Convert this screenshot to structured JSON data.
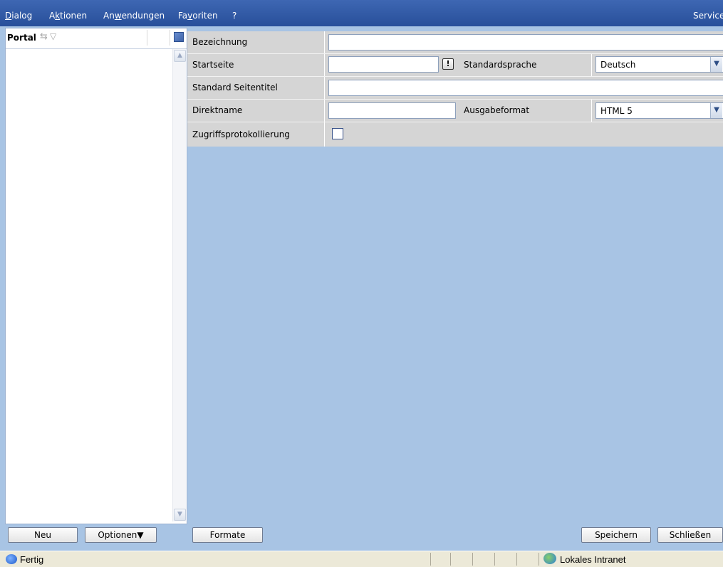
{
  "menu": {
    "items": [
      {
        "pre": "",
        "key": "D",
        "post": "ialog"
      },
      {
        "pre": "A",
        "key": "k",
        "post": "tionen"
      },
      {
        "pre": "An",
        "key": "w",
        "post": "endungen"
      },
      {
        "pre": "Fa",
        "key": "v",
        "post": "oriten"
      },
      {
        "pre": "?",
        "key": "",
        "post": ""
      }
    ],
    "service": "Service"
  },
  "left_panel": {
    "title": "Portal",
    "new_button": "Neu",
    "options_button": "Optionen▼"
  },
  "form": {
    "bezeichnung_label": "Bezeichnung",
    "bezeichnung_value": "",
    "startseite_label": "Startseite",
    "startseite_value": "",
    "warn_symbol": "!",
    "standardsprache_label": "Standardsprache",
    "standardsprache_value": "Deutsch",
    "seitentitel_label": "Standard Seitentitel",
    "seitentitel_value": "",
    "direktname_label": "Direktname",
    "direktname_value": "",
    "ausgabeformat_label": "Ausgabeformat",
    "ausgabeformat_value": "HTML 5",
    "zugriff_label": "Zugriffsprotokollierung",
    "zugriff_checked": false
  },
  "buttons": {
    "formate": "Formate",
    "speichern": "Speichern",
    "schliessen": "Schließen"
  },
  "statusbar": {
    "status": "Fertig",
    "zone": "Lokales Intranet"
  }
}
